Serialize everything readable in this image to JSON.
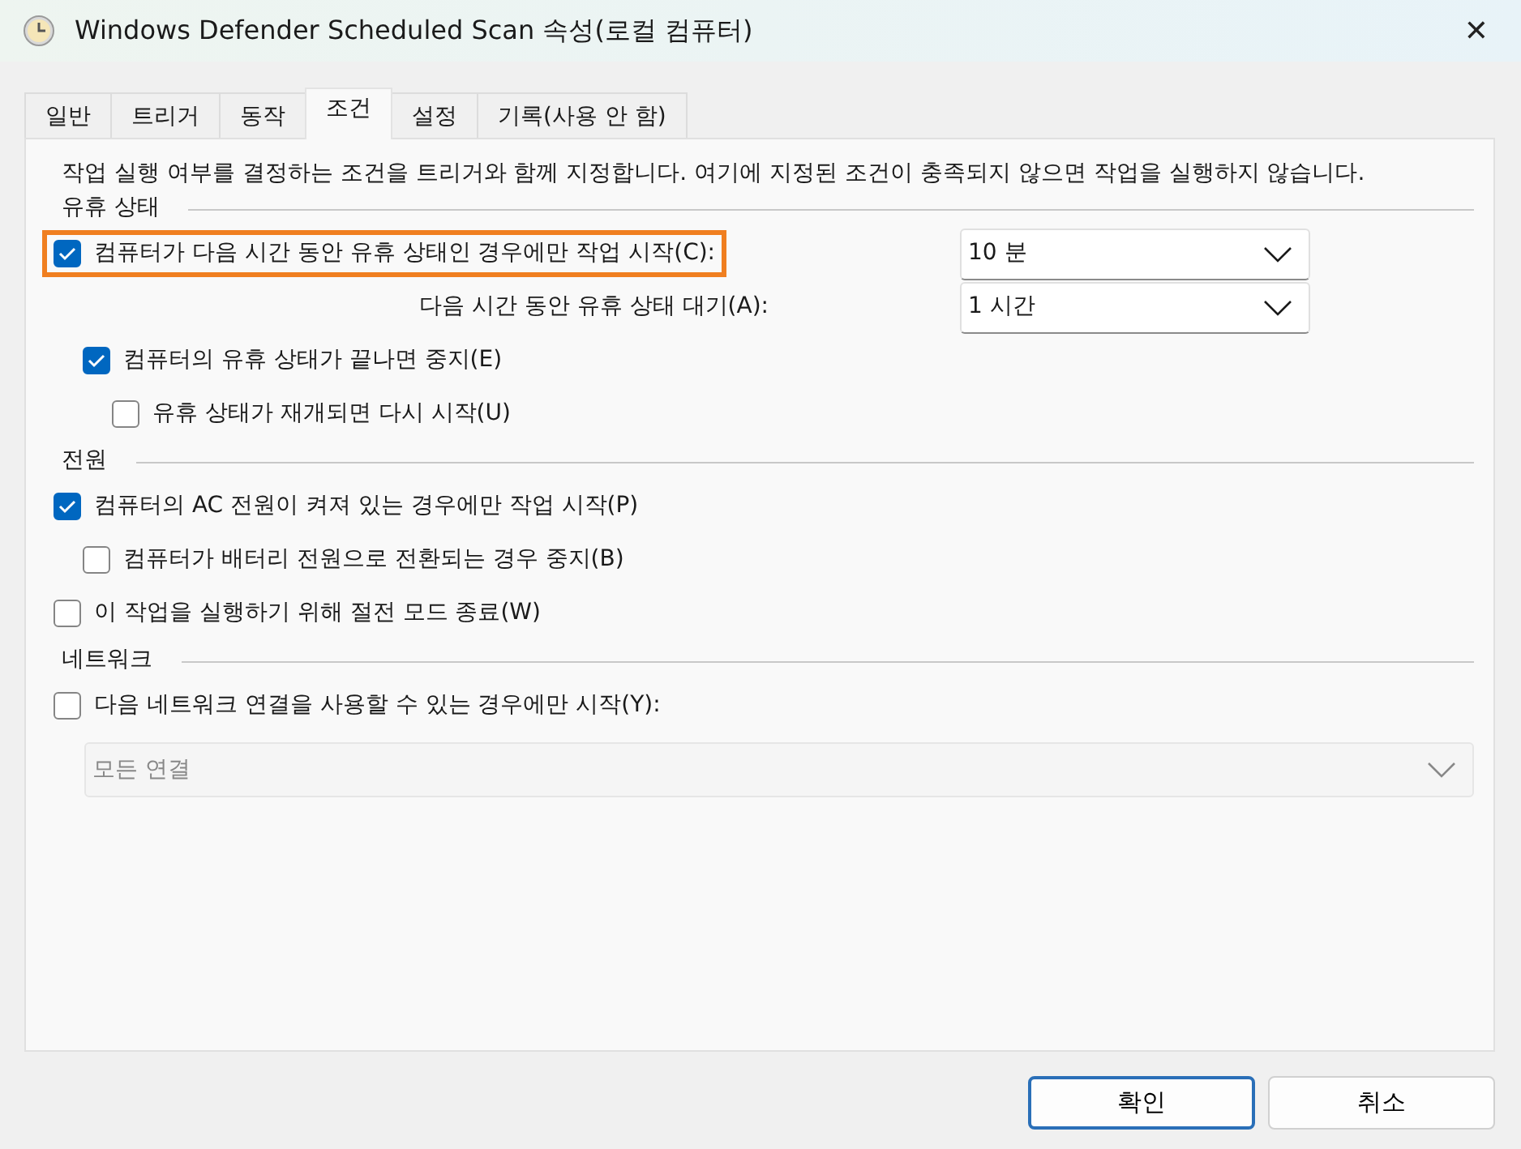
{
  "window": {
    "title": "Windows Defender Scheduled Scan 속성(로컬 컴퓨터)",
    "close": "✕"
  },
  "tabs": [
    {
      "label": "일반",
      "selected": false
    },
    {
      "label": "트리거",
      "selected": false
    },
    {
      "label": "동작",
      "selected": false
    },
    {
      "label": "조건",
      "selected": true
    },
    {
      "label": "설정",
      "selected": false
    },
    {
      "label": "기록(사용 안 함)",
      "selected": false
    }
  ],
  "description": "작업 실행 여부를 결정하는 조건을 트리거와 함께 지정합니다. 여기에 지정된 조건이 충족되지 않으면 작업을 실행하지 않습니다.",
  "sections": [
    {
      "title": "유휴 상태",
      "items": [
        {
          "kind": "checkbox",
          "label": "컴퓨터가 다음 시간 동안 유휴 상태인 경우에만 작업 시작(C):",
          "checked": true,
          "highlighted": true,
          "select": {
            "value": "10 분",
            "disabled": false
          },
          "children": [
            {
              "kind": "select-row",
              "label": "다음 시간 동안 유휴 상태 대기(A):",
              "select": {
                "value": "1 시간",
                "disabled": false
              }
            },
            {
              "kind": "checkbox",
              "label": "컴퓨터의 유휴 상태가 끝나면 중지(E)",
              "checked": true,
              "highlighted": false,
              "children": [
                {
                  "kind": "checkbox",
                  "label": "유휴 상태가 재개되면 다시 시작(U)",
                  "checked": false,
                  "highlighted": false
                }
              ]
            }
          ]
        }
      ]
    },
    {
      "title": "전원",
      "items": [
        {
          "kind": "checkbox",
          "label": "컴퓨터의 AC 전원이 켜져 있는 경우에만 작업 시작(P)",
          "checked": true,
          "highlighted": false,
          "children": [
            {
              "kind": "checkbox",
              "label": "컴퓨터가 배터리 전원으로 전환되는 경우 중지(B)",
              "checked": false,
              "highlighted": false
            }
          ]
        },
        {
          "kind": "checkbox",
          "label": "이 작업을 실행하기 위해 절전 모드 종료(W)",
          "checked": false,
          "highlighted": false
        }
      ]
    },
    {
      "title": "네트워크",
      "items": [
        {
          "kind": "checkbox",
          "label": "다음 네트워크 연결을 사용할 수 있는 경우에만 시작(Y):",
          "checked": false,
          "highlighted": false
        },
        {
          "kind": "wide-select",
          "select": {
            "value": "모든 연결",
            "disabled": true
          }
        }
      ]
    }
  ],
  "buttons": [
    {
      "label": "확인",
      "default": true
    },
    {
      "label": "취소",
      "default": false
    }
  ]
}
